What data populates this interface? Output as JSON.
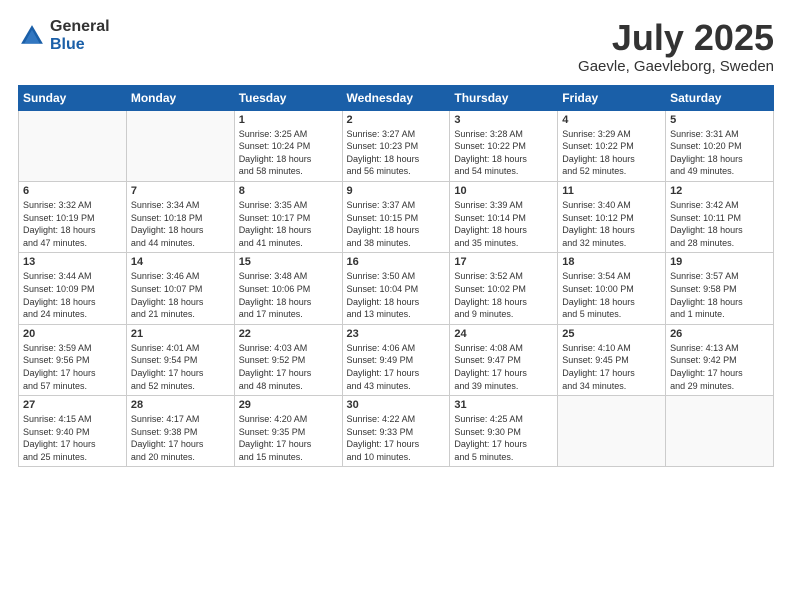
{
  "logo": {
    "general": "General",
    "blue": "Blue"
  },
  "title": "July 2025",
  "location": "Gaevle, Gaevleborg, Sweden",
  "weekdays": [
    "Sunday",
    "Monday",
    "Tuesday",
    "Wednesday",
    "Thursday",
    "Friday",
    "Saturday"
  ],
  "weeks": [
    [
      {
        "day": "",
        "info": ""
      },
      {
        "day": "",
        "info": ""
      },
      {
        "day": "1",
        "info": "Sunrise: 3:25 AM\nSunset: 10:24 PM\nDaylight: 18 hours\nand 58 minutes."
      },
      {
        "day": "2",
        "info": "Sunrise: 3:27 AM\nSunset: 10:23 PM\nDaylight: 18 hours\nand 56 minutes."
      },
      {
        "day": "3",
        "info": "Sunrise: 3:28 AM\nSunset: 10:22 PM\nDaylight: 18 hours\nand 54 minutes."
      },
      {
        "day": "4",
        "info": "Sunrise: 3:29 AM\nSunset: 10:22 PM\nDaylight: 18 hours\nand 52 minutes."
      },
      {
        "day": "5",
        "info": "Sunrise: 3:31 AM\nSunset: 10:20 PM\nDaylight: 18 hours\nand 49 minutes."
      }
    ],
    [
      {
        "day": "6",
        "info": "Sunrise: 3:32 AM\nSunset: 10:19 PM\nDaylight: 18 hours\nand 47 minutes."
      },
      {
        "day": "7",
        "info": "Sunrise: 3:34 AM\nSunset: 10:18 PM\nDaylight: 18 hours\nand 44 minutes."
      },
      {
        "day": "8",
        "info": "Sunrise: 3:35 AM\nSunset: 10:17 PM\nDaylight: 18 hours\nand 41 minutes."
      },
      {
        "day": "9",
        "info": "Sunrise: 3:37 AM\nSunset: 10:15 PM\nDaylight: 18 hours\nand 38 minutes."
      },
      {
        "day": "10",
        "info": "Sunrise: 3:39 AM\nSunset: 10:14 PM\nDaylight: 18 hours\nand 35 minutes."
      },
      {
        "day": "11",
        "info": "Sunrise: 3:40 AM\nSunset: 10:12 PM\nDaylight: 18 hours\nand 32 minutes."
      },
      {
        "day": "12",
        "info": "Sunrise: 3:42 AM\nSunset: 10:11 PM\nDaylight: 18 hours\nand 28 minutes."
      }
    ],
    [
      {
        "day": "13",
        "info": "Sunrise: 3:44 AM\nSunset: 10:09 PM\nDaylight: 18 hours\nand 24 minutes."
      },
      {
        "day": "14",
        "info": "Sunrise: 3:46 AM\nSunset: 10:07 PM\nDaylight: 18 hours\nand 21 minutes."
      },
      {
        "day": "15",
        "info": "Sunrise: 3:48 AM\nSunset: 10:06 PM\nDaylight: 18 hours\nand 17 minutes."
      },
      {
        "day": "16",
        "info": "Sunrise: 3:50 AM\nSunset: 10:04 PM\nDaylight: 18 hours\nand 13 minutes."
      },
      {
        "day": "17",
        "info": "Sunrise: 3:52 AM\nSunset: 10:02 PM\nDaylight: 18 hours\nand 9 minutes."
      },
      {
        "day": "18",
        "info": "Sunrise: 3:54 AM\nSunset: 10:00 PM\nDaylight: 18 hours\nand 5 minutes."
      },
      {
        "day": "19",
        "info": "Sunrise: 3:57 AM\nSunset: 9:58 PM\nDaylight: 18 hours\nand 1 minute."
      }
    ],
    [
      {
        "day": "20",
        "info": "Sunrise: 3:59 AM\nSunset: 9:56 PM\nDaylight: 17 hours\nand 57 minutes."
      },
      {
        "day": "21",
        "info": "Sunrise: 4:01 AM\nSunset: 9:54 PM\nDaylight: 17 hours\nand 52 minutes."
      },
      {
        "day": "22",
        "info": "Sunrise: 4:03 AM\nSunset: 9:52 PM\nDaylight: 17 hours\nand 48 minutes."
      },
      {
        "day": "23",
        "info": "Sunrise: 4:06 AM\nSunset: 9:49 PM\nDaylight: 17 hours\nand 43 minutes."
      },
      {
        "day": "24",
        "info": "Sunrise: 4:08 AM\nSunset: 9:47 PM\nDaylight: 17 hours\nand 39 minutes."
      },
      {
        "day": "25",
        "info": "Sunrise: 4:10 AM\nSunset: 9:45 PM\nDaylight: 17 hours\nand 34 minutes."
      },
      {
        "day": "26",
        "info": "Sunrise: 4:13 AM\nSunset: 9:42 PM\nDaylight: 17 hours\nand 29 minutes."
      }
    ],
    [
      {
        "day": "27",
        "info": "Sunrise: 4:15 AM\nSunset: 9:40 PM\nDaylight: 17 hours\nand 25 minutes."
      },
      {
        "day": "28",
        "info": "Sunrise: 4:17 AM\nSunset: 9:38 PM\nDaylight: 17 hours\nand 20 minutes."
      },
      {
        "day": "29",
        "info": "Sunrise: 4:20 AM\nSunset: 9:35 PM\nDaylight: 17 hours\nand 15 minutes."
      },
      {
        "day": "30",
        "info": "Sunrise: 4:22 AM\nSunset: 9:33 PM\nDaylight: 17 hours\nand 10 minutes."
      },
      {
        "day": "31",
        "info": "Sunrise: 4:25 AM\nSunset: 9:30 PM\nDaylight: 17 hours\nand 5 minutes."
      },
      {
        "day": "",
        "info": ""
      },
      {
        "day": "",
        "info": ""
      }
    ]
  ]
}
